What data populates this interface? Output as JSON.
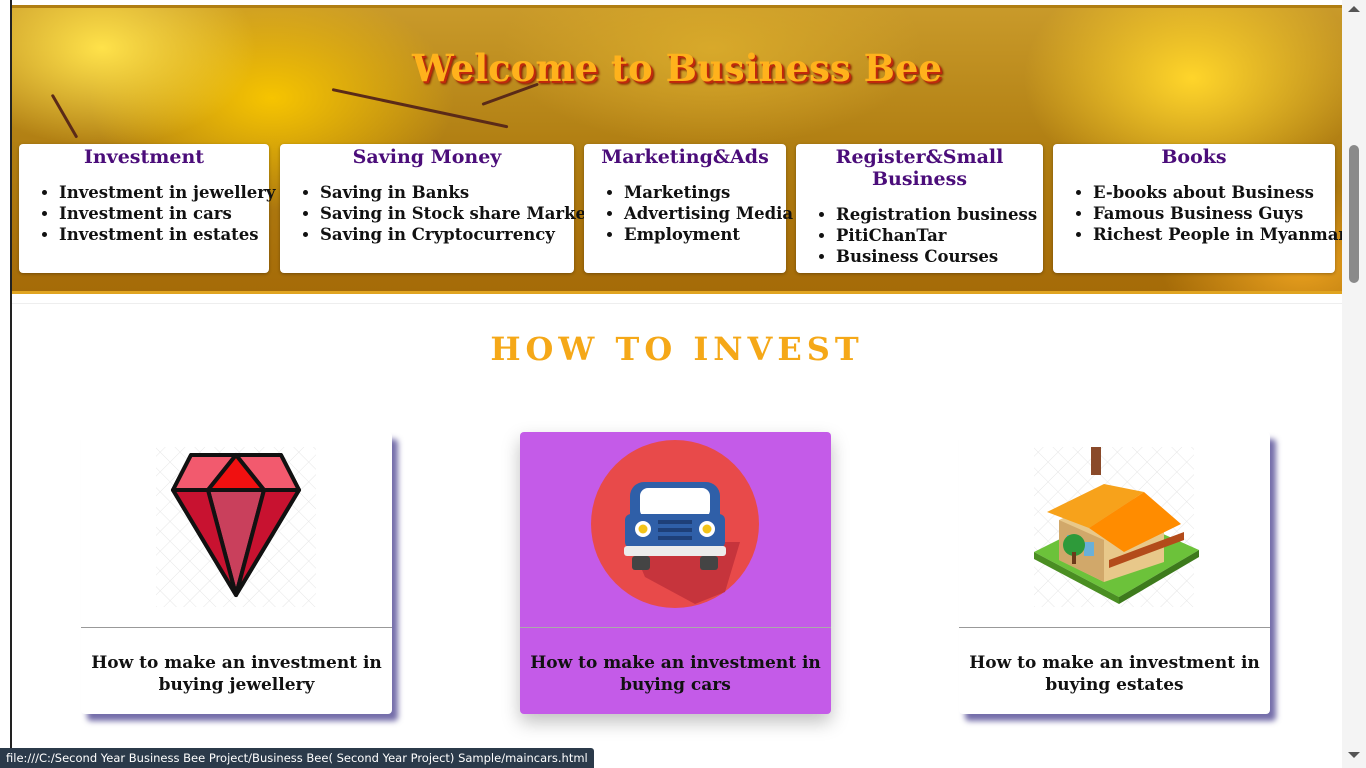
{
  "header": {
    "title": "Welcome to Business Bee"
  },
  "menu": [
    {
      "heading": "Investment",
      "items": [
        "Investment in jewellery",
        "Investment in cars",
        "Investment in estates"
      ]
    },
    {
      "heading": "Saving Money",
      "items": [
        "Saving in Banks",
        "Saving in Stock share Market",
        "Saving in Cryptocurrency"
      ]
    },
    {
      "heading": "Marketing&Ads",
      "items": [
        "Marketings",
        "Advertising Media",
        "Employment"
      ]
    },
    {
      "heading": "Register&Small Business",
      "items": [
        "Registration business",
        "PitiChanTar",
        "Business Courses"
      ]
    },
    {
      "heading": "Books",
      "items": [
        "E-books about Business",
        "Famous Business Guys",
        "Richest People in Myanmar"
      ]
    }
  ],
  "section": {
    "title": "HOW TO INVEST"
  },
  "cards": [
    {
      "caption": "How to make an investment in buying jewellery",
      "icon": "diamond-icon"
    },
    {
      "caption": "How to make an investment in buying cars",
      "icon": "car-icon"
    },
    {
      "caption": "How to make an investment in buying estates",
      "icon": "house-icon"
    }
  ],
  "status": {
    "url": "file:///C:/Second Year Business Bee Project/Business Bee( Second Year Project) Sample/maincars.html"
  },
  "colors": {
    "accent": "#f5a818",
    "menu_heading": "#4b0d7a",
    "card_active": "#c45be8",
    "card_shadow": "#463c8c"
  }
}
